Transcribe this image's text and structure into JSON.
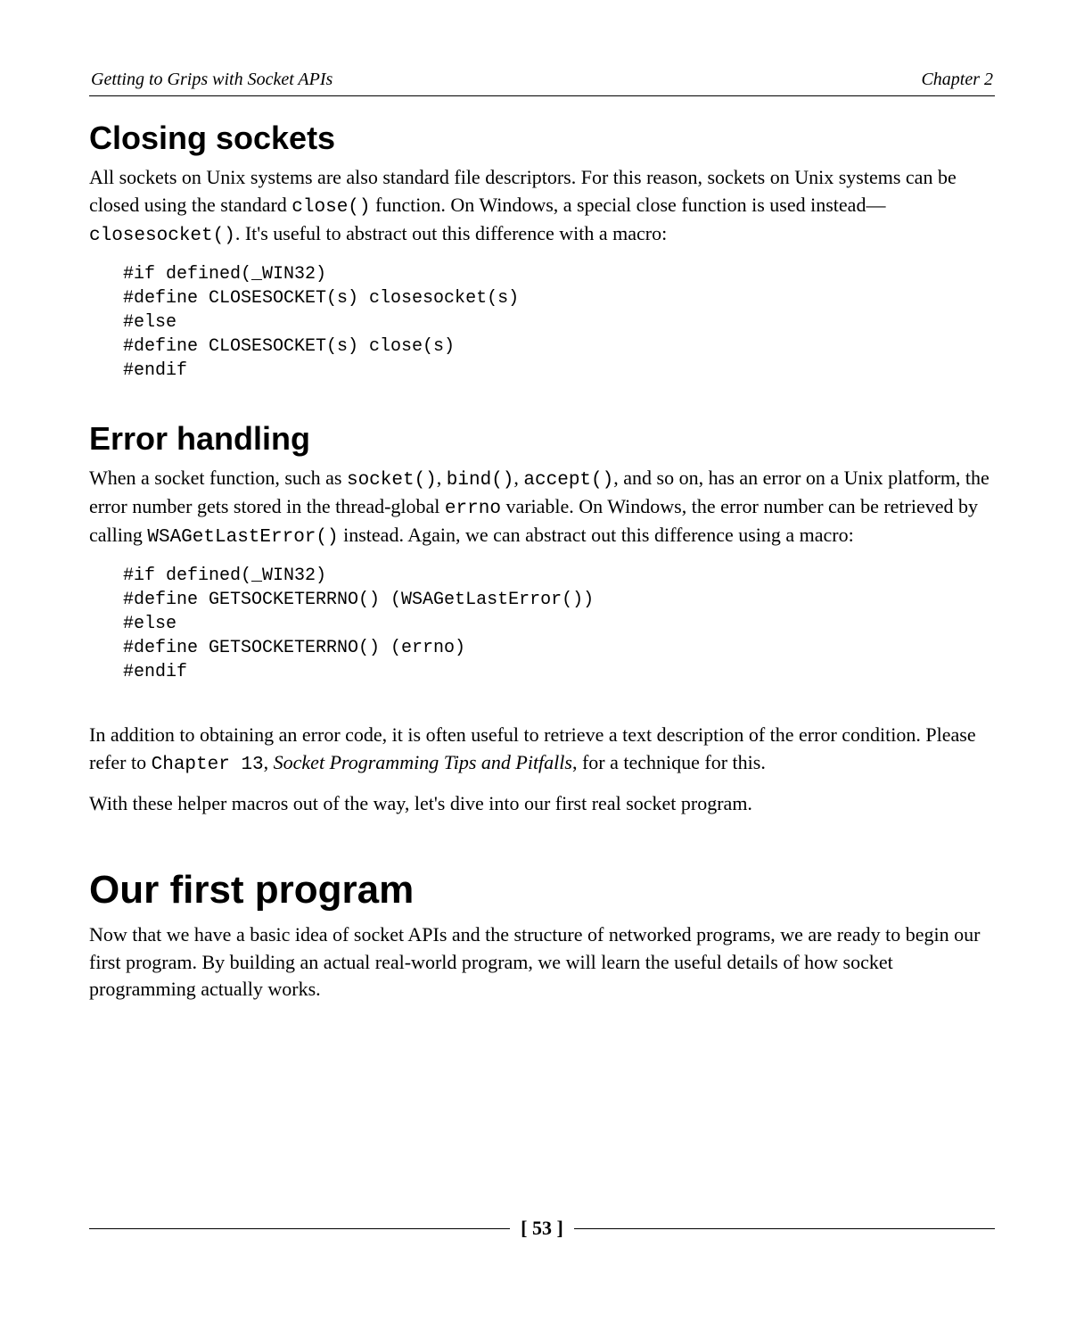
{
  "header": {
    "left": "Getting to Grips with Socket APIs",
    "right": "Chapter 2"
  },
  "sections": {
    "closing": {
      "title": "Closing sockets",
      "para": {
        "t1": "All sockets on Unix systems are also standard file descriptors. For this reason, sockets on Unix systems can be closed using the standard ",
        "code1": "close()",
        "t2": " function. On Windows, a special close function is used instead—",
        "code2": "closesocket()",
        "t3": ". It's useful to abstract out this difference with a macro:"
      },
      "code": "#if defined(_WIN32)\n#define CLOSESOCKET(s) closesocket(s)\n#else\n#define CLOSESOCKET(s) close(s)\n#endif"
    },
    "error": {
      "title": "Error handling",
      "para1": {
        "t1": "When a socket function, such as ",
        "code1": "socket()",
        "t2": ", ",
        "code2": "bind()",
        "t3": ", ",
        "code3": "accept()",
        "t4": ", and so on, has an error on a Unix platform, the error number gets stored in the thread-global ",
        "code4": "errno",
        "t5": " variable. On Windows, the error number can be retrieved by calling ",
        "code5": "WSAGetLastError()",
        "t6": " instead. Again, we can abstract out this difference using a macro:"
      },
      "code": "#if defined(_WIN32)\n#define GETSOCKETERRNO() (WSAGetLastError())\n#else\n#define GETSOCKETERRNO() (errno)\n#endif",
      "para2": {
        "t1": "In addition to obtaining an error code, it is often useful to retrieve a text description of the error condition. Please refer to ",
        "code1": "Chapter 13",
        "t2": ", ",
        "ital1": "Socket Programming Tips and Pitfalls",
        "t3": ", for a technique for this."
      },
      "para3": "With these helper macros out of the way, let's dive into our first real socket program."
    },
    "first": {
      "title": "Our first program",
      "para": "Now that we have a basic idea of socket APIs and the structure of networked programs, we are ready to begin our first program. By building an actual real-world program, we will learn the useful details of how socket programming actually works."
    }
  },
  "footer": {
    "page": "[ 53 ]"
  }
}
